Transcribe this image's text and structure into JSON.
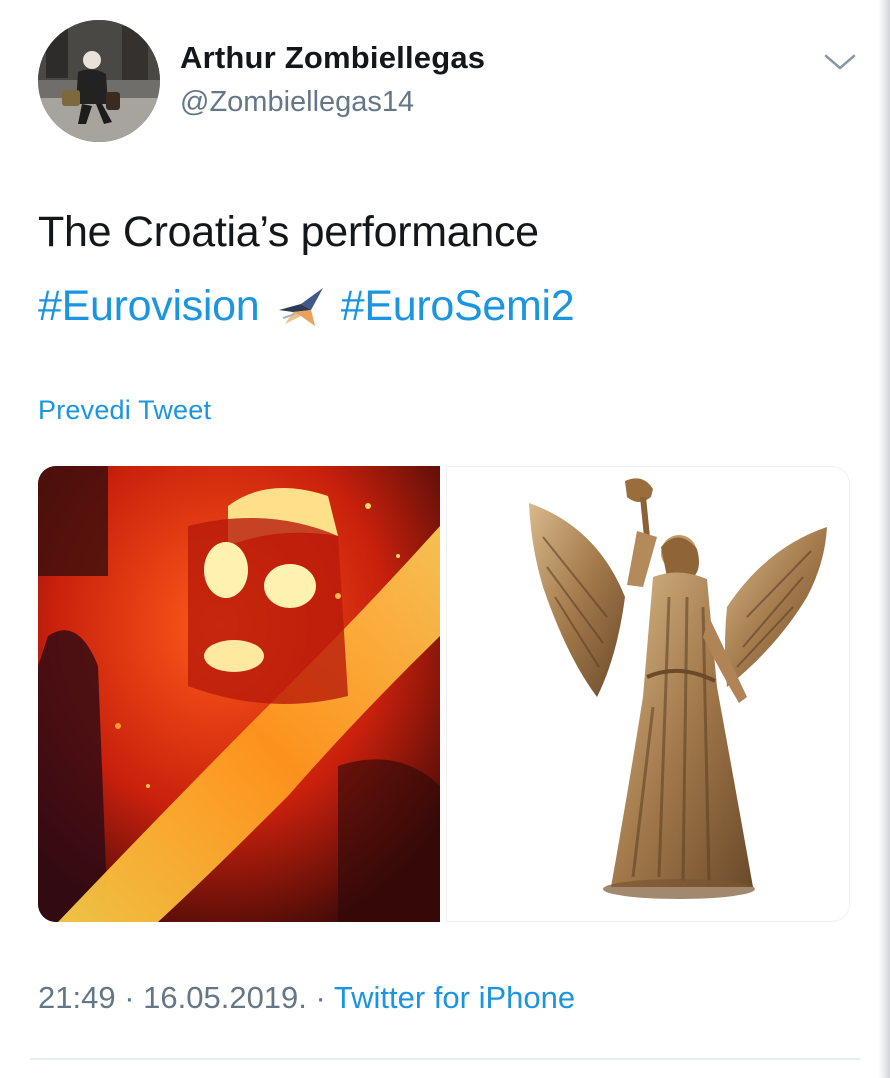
{
  "author": {
    "display_name": "Arthur Zombiellegas",
    "handle": "@Zombiellegas14",
    "avatar_icon": "person-photo-avatar"
  },
  "tweet": {
    "text": "The Croatia’s performance",
    "hashtags": [
      "#Eurovision",
      "#EuroSemi2"
    ],
    "hashtag_emoji_icon": "eurovision-star-emoji",
    "translate_label": "Prevedi Tweet"
  },
  "media": [
    {
      "description_icon": "fire-figure-image"
    },
    {
      "description_icon": "bronze-angel-statue-image"
    }
  ],
  "meta": {
    "time": "21:49",
    "separator": " · ",
    "date": "16.05.2019.",
    "source": "Twitter for iPhone"
  },
  "menu": {
    "icon": "chevron-down-icon"
  },
  "colors": {
    "link": "#1b95e0",
    "secondary": "#657786",
    "text": "#14171a"
  }
}
